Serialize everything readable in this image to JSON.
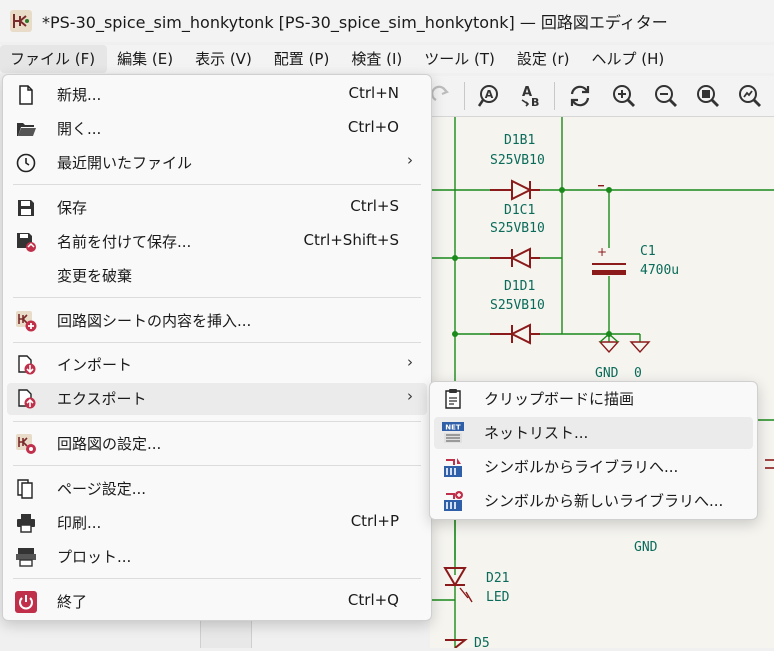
{
  "window": {
    "title": "*PS-30_spice_sim_honkytonk [PS-30_spice_sim_honkytonk] — 回路図エディター"
  },
  "menubar": {
    "items": [
      {
        "label": "ファイル (F)"
      },
      {
        "label": "編集 (E)"
      },
      {
        "label": "表示 (V)"
      },
      {
        "label": "配置 (P)"
      },
      {
        "label": "検査 (I)"
      },
      {
        "label": "ツール (T)"
      },
      {
        "label": "設定 (r)"
      },
      {
        "label": "ヘルプ (H)"
      }
    ]
  },
  "toolbar": {
    "icons": [
      "redo-icon",
      "find-icon",
      "find-replace-icon",
      "refresh-icon",
      "zoom-in-icon",
      "zoom-out-icon",
      "zoom-fit-icon",
      "zoom-area-icon"
    ]
  },
  "file_menu": {
    "items": [
      {
        "label": "新規...",
        "shortcut": "Ctrl+N",
        "icon": "new-file-icon"
      },
      {
        "label": "開く...",
        "shortcut": "Ctrl+O",
        "icon": "open-folder-icon"
      },
      {
        "label": "最近開いたファイル",
        "shortcut": "",
        "icon": "clock-icon",
        "submenu": true
      },
      {
        "label": "保存",
        "shortcut": "Ctrl+S",
        "icon": "save-icon"
      },
      {
        "label": "名前を付けて保存...",
        "shortcut": "Ctrl+Shift+S",
        "icon": "save-as-icon"
      },
      {
        "label": "変更を破棄",
        "shortcut": "",
        "icon": ""
      },
      {
        "label": "回路図シートの内容を挿入...",
        "shortcut": "",
        "icon": "insert-sheet-icon"
      },
      {
        "label": "インポート",
        "shortcut": "",
        "icon": "import-icon",
        "submenu": true
      },
      {
        "label": "エクスポート",
        "shortcut": "",
        "icon": "export-icon",
        "submenu": true
      },
      {
        "label": "回路図の設定...",
        "shortcut": "",
        "icon": "schematic-settings-icon"
      },
      {
        "label": "ページ設定...",
        "shortcut": "",
        "icon": "page-setup-icon"
      },
      {
        "label": "印刷...",
        "shortcut": "Ctrl+P",
        "icon": "print-icon"
      },
      {
        "label": "プロット...",
        "shortcut": "",
        "icon": "plot-icon"
      },
      {
        "label": "終了",
        "shortcut": "Ctrl+Q",
        "icon": "power-icon"
      }
    ]
  },
  "export_submenu": {
    "items": [
      {
        "label": "クリップボードに描画",
        "icon": "clipboard-icon"
      },
      {
        "label": "ネットリスト...",
        "icon": "netlist-icon",
        "badge": "NET"
      },
      {
        "label": "シンボルからライブラリへ...",
        "icon": "symbol-library-icon"
      },
      {
        "label": "シンボルから新しいライブラリへ...",
        "icon": "symbol-new-library-icon"
      }
    ]
  },
  "schematic": {
    "labels": [
      {
        "text": "D1B1"
      },
      {
        "text": "S25VB10"
      },
      {
        "text": "D1C1"
      },
      {
        "text": "S25VB10"
      },
      {
        "text": "D1D1"
      },
      {
        "text": "S25VB10"
      },
      {
        "text": "C1"
      },
      {
        "text": "4700u"
      },
      {
        "text": "GND"
      },
      {
        "text": "0"
      },
      {
        "text": "GND"
      },
      {
        "text": "D21"
      },
      {
        "text": "LED"
      },
      {
        "text": "D5"
      }
    ]
  },
  "colors": {
    "wire": "#1a8a1a",
    "component": "#8b1a1a",
    "label": "#0b6b5a",
    "canvas": "#f5f4ef"
  }
}
